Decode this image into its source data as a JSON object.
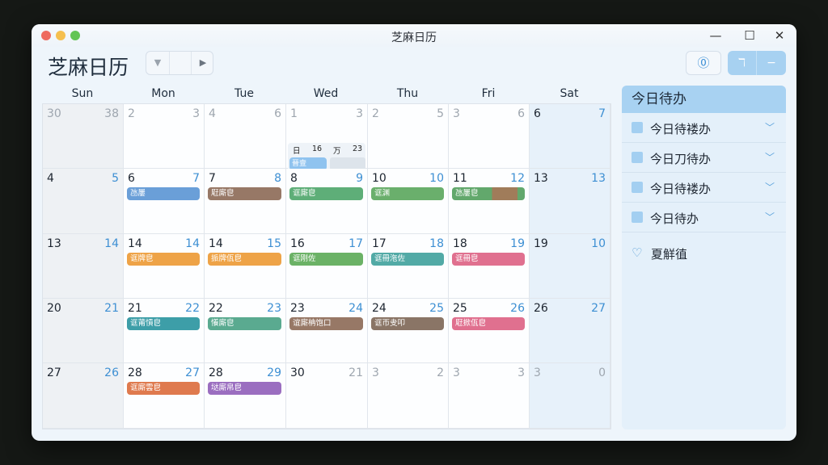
{
  "window": {
    "title": "芝麻日历"
  },
  "header": {
    "app_title": "芝麻日历",
    "nav_prev_icon": "▼",
    "nav_next_icon": "▶",
    "help_icon": "⓪",
    "seg_a": "ℸ",
    "seg_b": "−"
  },
  "weekdays": [
    "Sun",
    "Mon",
    "Tue",
    "Wed",
    "Thu",
    "Fri",
    "Sat"
  ],
  "weeks": [
    [
      {
        "l": "30",
        "r": "38",
        "muted": true
      },
      {
        "l": "2",
        "r": "3",
        "muted": true
      },
      {
        "l": "4",
        "r": "6",
        "muted": true
      },
      {
        "l": "1",
        "r": "3",
        "muted": true
      },
      {
        "l": "2",
        "r": "5",
        "muted": true
      },
      {
        "l": "3",
        "r": "6",
        "muted": true
      },
      {
        "l": "6",
        "r": "7"
      }
    ],
    [
      {
        "l": "4",
        "r": "5"
      },
      {
        "l": "6",
        "r": "7",
        "event": {
          "label": "氹屢",
          "color": "#6a9fd8"
        }
      },
      {
        "l": "7",
        "r": "8",
        "event": {
          "label": "屘廝皀",
          "color": "#977866"
        }
      },
      {
        "l": "8",
        "r": "9",
        "event": {
          "label": "诓廝皀",
          "color": "#5eae78"
        }
      },
      {
        "l": "10",
        "r": "10",
        "event": {
          "label": "诓渊",
          "color": "#6aaf6c"
        }
      },
      {
        "l": "11",
        "r": "12",
        "event": {
          "label": "氹屢皀",
          "color": "#62a86c",
          "color2": "#a07c5a"
        }
      },
      {
        "l": "13",
        "r": "13"
      }
    ],
    [
      {
        "l": "13",
        "r": "14"
      },
      {
        "l": "14",
        "r": "14",
        "event": {
          "label": "诓牌皀",
          "color": "#eea347"
        }
      },
      {
        "l": "14",
        "r": "15",
        "event": {
          "label": "挀牌佤皀",
          "color": "#eea347"
        }
      },
      {
        "l": "16",
        "r": "17",
        "event": {
          "label": "诓刚佐",
          "color": "#6bb266"
        }
      },
      {
        "l": "17",
        "r": "18",
        "event": {
          "label": "诓冊沲佐",
          "color": "#52aaa6"
        }
      },
      {
        "l": "18",
        "r": "19",
        "event": {
          "label": "诓冊皀",
          "color": "#e0708f"
        }
      },
      {
        "l": "19",
        "r": "10"
      }
    ],
    [
      {
        "l": "20",
        "r": "21"
      },
      {
        "l": "21",
        "r": "22",
        "event": {
          "label": "诓莆愩皀",
          "color": "#3d9ea8"
        }
      },
      {
        "l": "22",
        "r": "23",
        "event": {
          "label": "懩廝皀",
          "color": "#5aaa90"
        }
      },
      {
        "l": "23",
        "r": "24",
        "event": {
          "label": "谊廝柟饱口",
          "color": "#977866"
        }
      },
      {
        "l": "24",
        "r": "25",
        "event": {
          "label": "诓帀叏叩",
          "color": "#8a7566"
        }
      },
      {
        "l": "25",
        "r": "26",
        "event": {
          "label": "屘掀佤皀",
          "color": "#e0708f"
        }
      },
      {
        "l": "26",
        "r": "27"
      }
    ],
    [
      {
        "l": "27",
        "r": "26"
      },
      {
        "l": "28",
        "r": "27",
        "event": {
          "label": "诓廝雲皀",
          "color": "#df7a4e"
        }
      },
      {
        "l": "28",
        "r": "29",
        "event": {
          "label": "垯廝帛皀",
          "color": "#9b6ec0"
        }
      },
      {
        "l": "30",
        "r": "21",
        "muted_r": true
      },
      {
        "l": "3",
        "r": "2",
        "muted": true
      },
      {
        "l": "3",
        "r": "3",
        "muted": true
      },
      {
        "l": "3",
        "r": "0",
        "muted": true
      }
    ]
  ],
  "popup": {
    "cols": [
      "日",
      "16",
      "万",
      "23"
    ],
    "tag": "晉壹"
  },
  "sidebar": {
    "title": "今日待办",
    "todos": [
      "今日待褛办",
      "今日刀待办",
      "今日待褛办",
      "今日待办"
    ],
    "chevron": "﹀",
    "extra_icon": "♡",
    "extra_label": "夏觧徝"
  }
}
